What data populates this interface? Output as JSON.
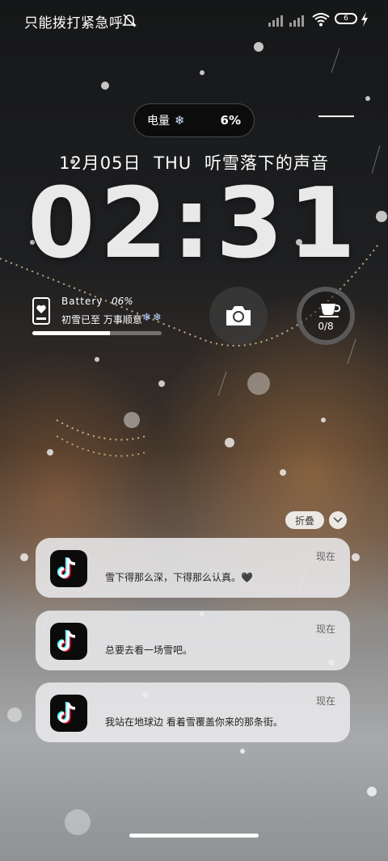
{
  "status_bar": {
    "carrier_text": "只能拨打紧急呼",
    "battery_level": "6",
    "icons": [
      "bell-off-icon",
      "signal-icon",
      "wifi-icon",
      "battery-icon",
      "charging-bolt-icon"
    ]
  },
  "power_pill": {
    "label": "电量",
    "icon": "snowflake-icon",
    "value": "6%"
  },
  "date_line": {
    "date": "12月05日",
    "weekday": "THU",
    "phrase": "听雪落下的声音"
  },
  "clock": {
    "time": "02:31"
  },
  "battery_widget": {
    "title": "Battery",
    "percent": "06%",
    "text": "初雪已至 万事顺意",
    "flakes": "❄❄",
    "level": 0.06
  },
  "cup_widget": {
    "count": "0/8"
  },
  "notification_controls": {
    "fold_label": "折叠"
  },
  "notifications": [
    {
      "app": "TikTok",
      "time": "现在",
      "text": "雪下得那么深，下得那么认真。🖤"
    },
    {
      "app": "TikTok",
      "time": "现在",
      "text": "总要去看一场雪吧。"
    },
    {
      "app": "TikTok",
      "time": "现在",
      "text": "我站在地球边 看着雪覆盖你来的那条街。"
    }
  ],
  "colors": {
    "accent_cyan": "#25f4ee",
    "accent_red": "#fe2c55",
    "card_bg": "#ebebed"
  }
}
